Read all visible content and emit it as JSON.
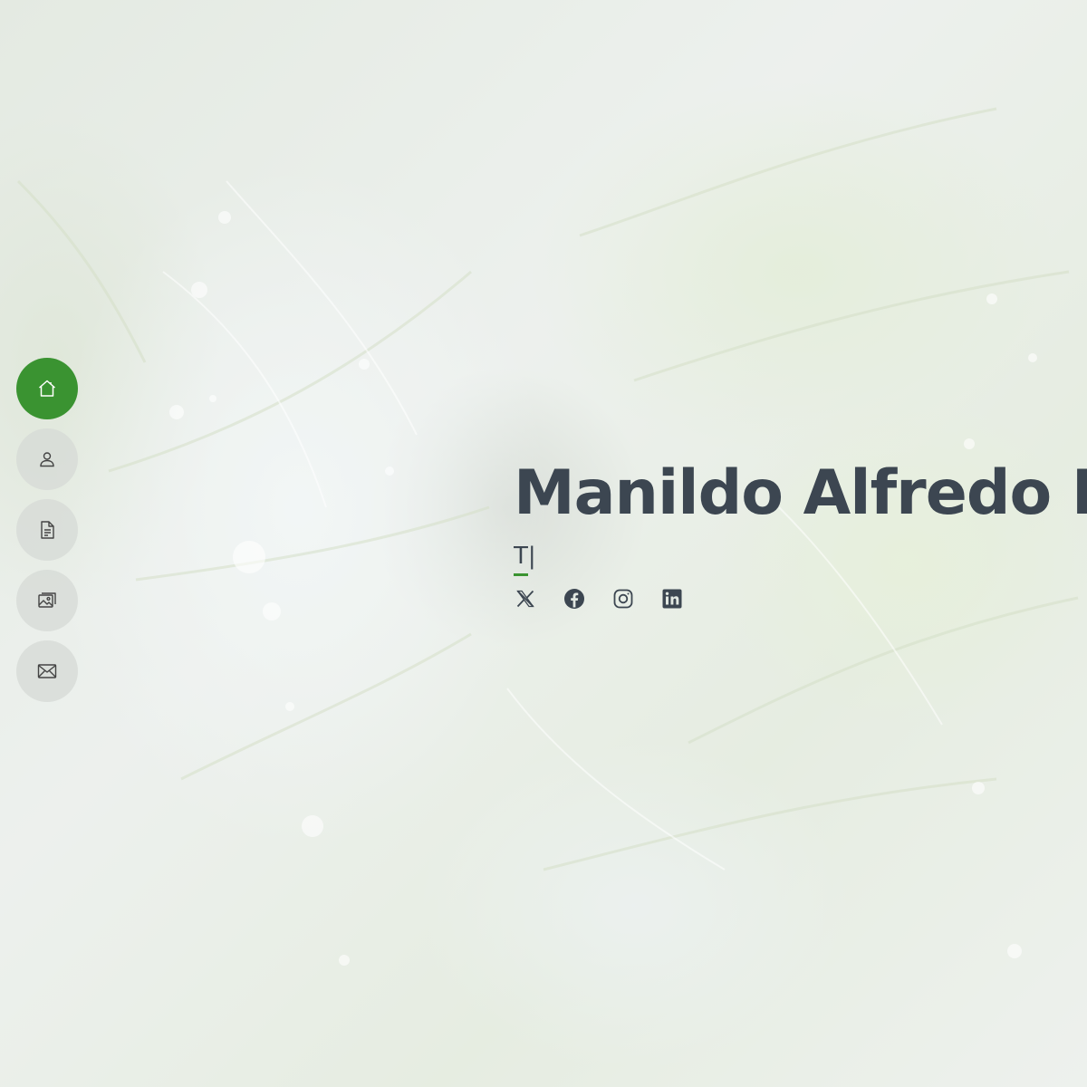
{
  "hero": {
    "name": "Manildo Alfredo M",
    "typed_text": "T",
    "typed_cursor": "|",
    "background_image": "cabbage-leaves-with-water-droplets"
  },
  "navigation": {
    "items": [
      {
        "name": "home",
        "icon": "house-icon",
        "active": true
      },
      {
        "name": "about",
        "icon": "person-icon",
        "active": false
      },
      {
        "name": "resume",
        "icon": "document-icon",
        "active": false
      },
      {
        "name": "portfolio",
        "icon": "images-icon",
        "active": false
      },
      {
        "name": "contact",
        "icon": "envelope-icon",
        "active": false
      }
    ]
  },
  "social": [
    {
      "name": "x-twitter",
      "icon": "x-twitter-icon"
    },
    {
      "name": "facebook",
      "icon": "facebook-icon"
    },
    {
      "name": "instagram",
      "icon": "instagram-icon"
    },
    {
      "name": "linkedin",
      "icon": "linkedin-icon"
    }
  ],
  "colors": {
    "accent": "#3a9331",
    "heading": "#3c4651",
    "nav_inactive": "#d6dad6"
  }
}
